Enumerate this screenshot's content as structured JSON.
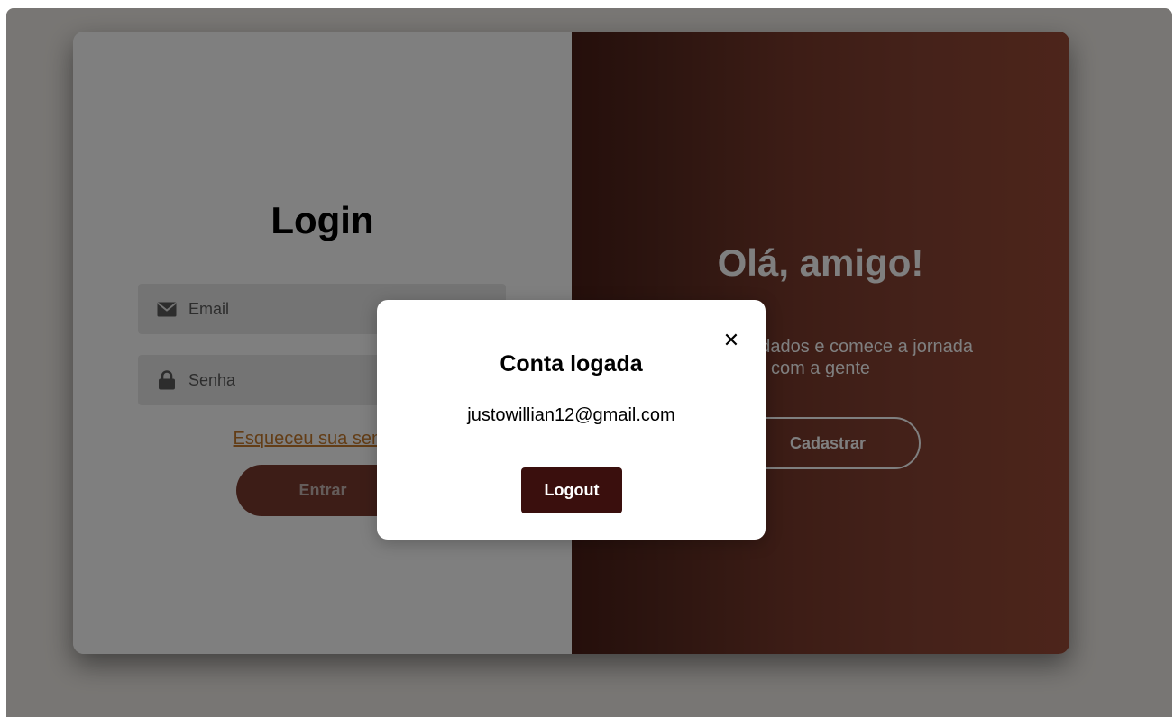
{
  "login": {
    "title": "Login",
    "email_placeholder": "Email",
    "password_placeholder": "Senha",
    "forgot_link": "Esqueceu sua senha?",
    "submit_label": "Entrar"
  },
  "welcome": {
    "title": "Olá, amigo!",
    "text_line1": "Insira seus dados e comece a jornada",
    "text_line2": "com a gente",
    "register_label": "Cadastrar"
  },
  "modal": {
    "close_symbol": "✕",
    "title": "Conta logada",
    "email": "justowillian12@gmail.com",
    "logout_label": "Logout"
  },
  "icons": {
    "email": "envelope-icon",
    "password": "lock-icon",
    "close": "close-icon"
  },
  "colors": {
    "accent_orange": "#c67a2c",
    "button_brown": "#7a3a2e",
    "logout_dark": "#3a0f0d",
    "overlay": "rgba(0,0,0,0.5)"
  }
}
